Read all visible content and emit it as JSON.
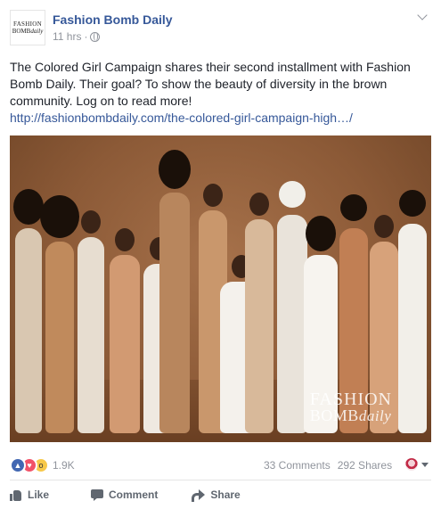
{
  "post": {
    "avatar": {
      "line1": "FASHION",
      "line2_prefix": "BOMB",
      "line2_italic": "daily"
    },
    "page_name": "Fashion Bomb Daily",
    "time": "11 hrs",
    "separator": "·",
    "privacy_icon": "globe-icon",
    "menu_icon": "chevron-down-icon",
    "text": "The Colored Girl Campaign shares their second installment with Fashion Bomb Daily. Their goal? To show the beauty of diversity in the brown community. Log on to read more!",
    "link": "http://fashionbombdaily.com/the-colored-girl-campaign-high…/",
    "image": {
      "watermark_line1": "FASHION",
      "watermark_line2_prefix": "BOMB",
      "watermark_line2_italic": "daily"
    }
  },
  "engagement": {
    "reaction_icons": [
      "like-reaction-icon",
      "love-reaction-icon",
      "wow-reaction-icon"
    ],
    "reaction_count": "1.9K",
    "comments": "33 Comments",
    "shares": "292 Shares"
  },
  "actions": {
    "like": "Like",
    "comment": "Comment",
    "share": "Share"
  },
  "colors": {
    "link_blue": "#365899",
    "text": "#1d2129",
    "muted": "#90949c",
    "like_blue": "#4267b2",
    "love_red": "#f25268",
    "wow_yellow": "#f7c849"
  }
}
